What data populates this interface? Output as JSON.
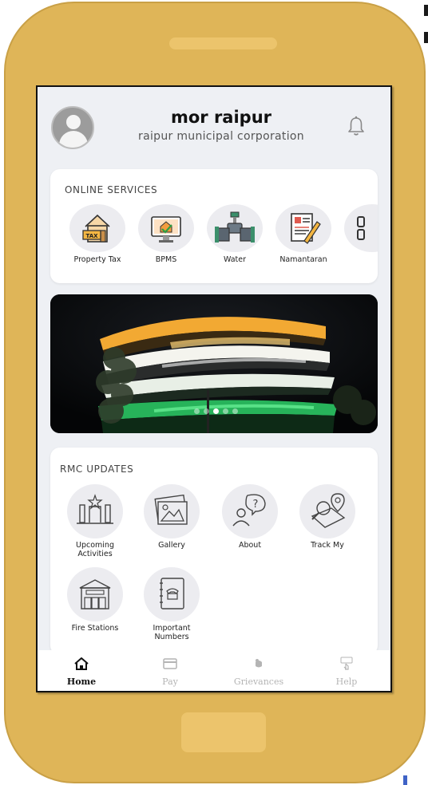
{
  "app": {
    "title": "mor raipur",
    "subtitle": "raipur municipal corporation"
  },
  "online_services": {
    "heading": "ONLINE SERVICES",
    "items": [
      {
        "label": "Property Tax",
        "icon": "property-tax-icon"
      },
      {
        "label": "BPMS",
        "icon": "bpms-icon"
      },
      {
        "label": "Water",
        "icon": "water-tap-icon"
      },
      {
        "label": "Namantaran",
        "icon": "namantaran-icon"
      }
    ]
  },
  "banner": {
    "slides": 5,
    "active_slide": 3
  },
  "rmc_updates": {
    "heading": "RMC UPDATES",
    "items": [
      {
        "label": "Upcoming Activities",
        "icon": "upcoming-activities-icon"
      },
      {
        "label": "Gallery",
        "icon": "gallery-icon"
      },
      {
        "label": "About",
        "icon": "about-icon"
      },
      {
        "label": "Track My",
        "icon": "track-my-icon"
      },
      {
        "label": "Fire Stations",
        "icon": "fire-station-icon"
      },
      {
        "label": "Important Numbers",
        "icon": "important-numbers-icon"
      }
    ]
  },
  "bottom_nav": {
    "items": [
      {
        "label": "Home",
        "icon": "home-icon",
        "active": true
      },
      {
        "label": "Pay",
        "icon": "card-icon",
        "active": false
      },
      {
        "label": "Grievances",
        "icon": "grievances-icon",
        "active": false
      },
      {
        "label": "Help",
        "icon": "help-icon",
        "active": false
      }
    ]
  },
  "colors": {
    "phone_frame": "#dfb558",
    "screen_bg": "#eef0f4",
    "icon_circle": "#ececf0"
  }
}
